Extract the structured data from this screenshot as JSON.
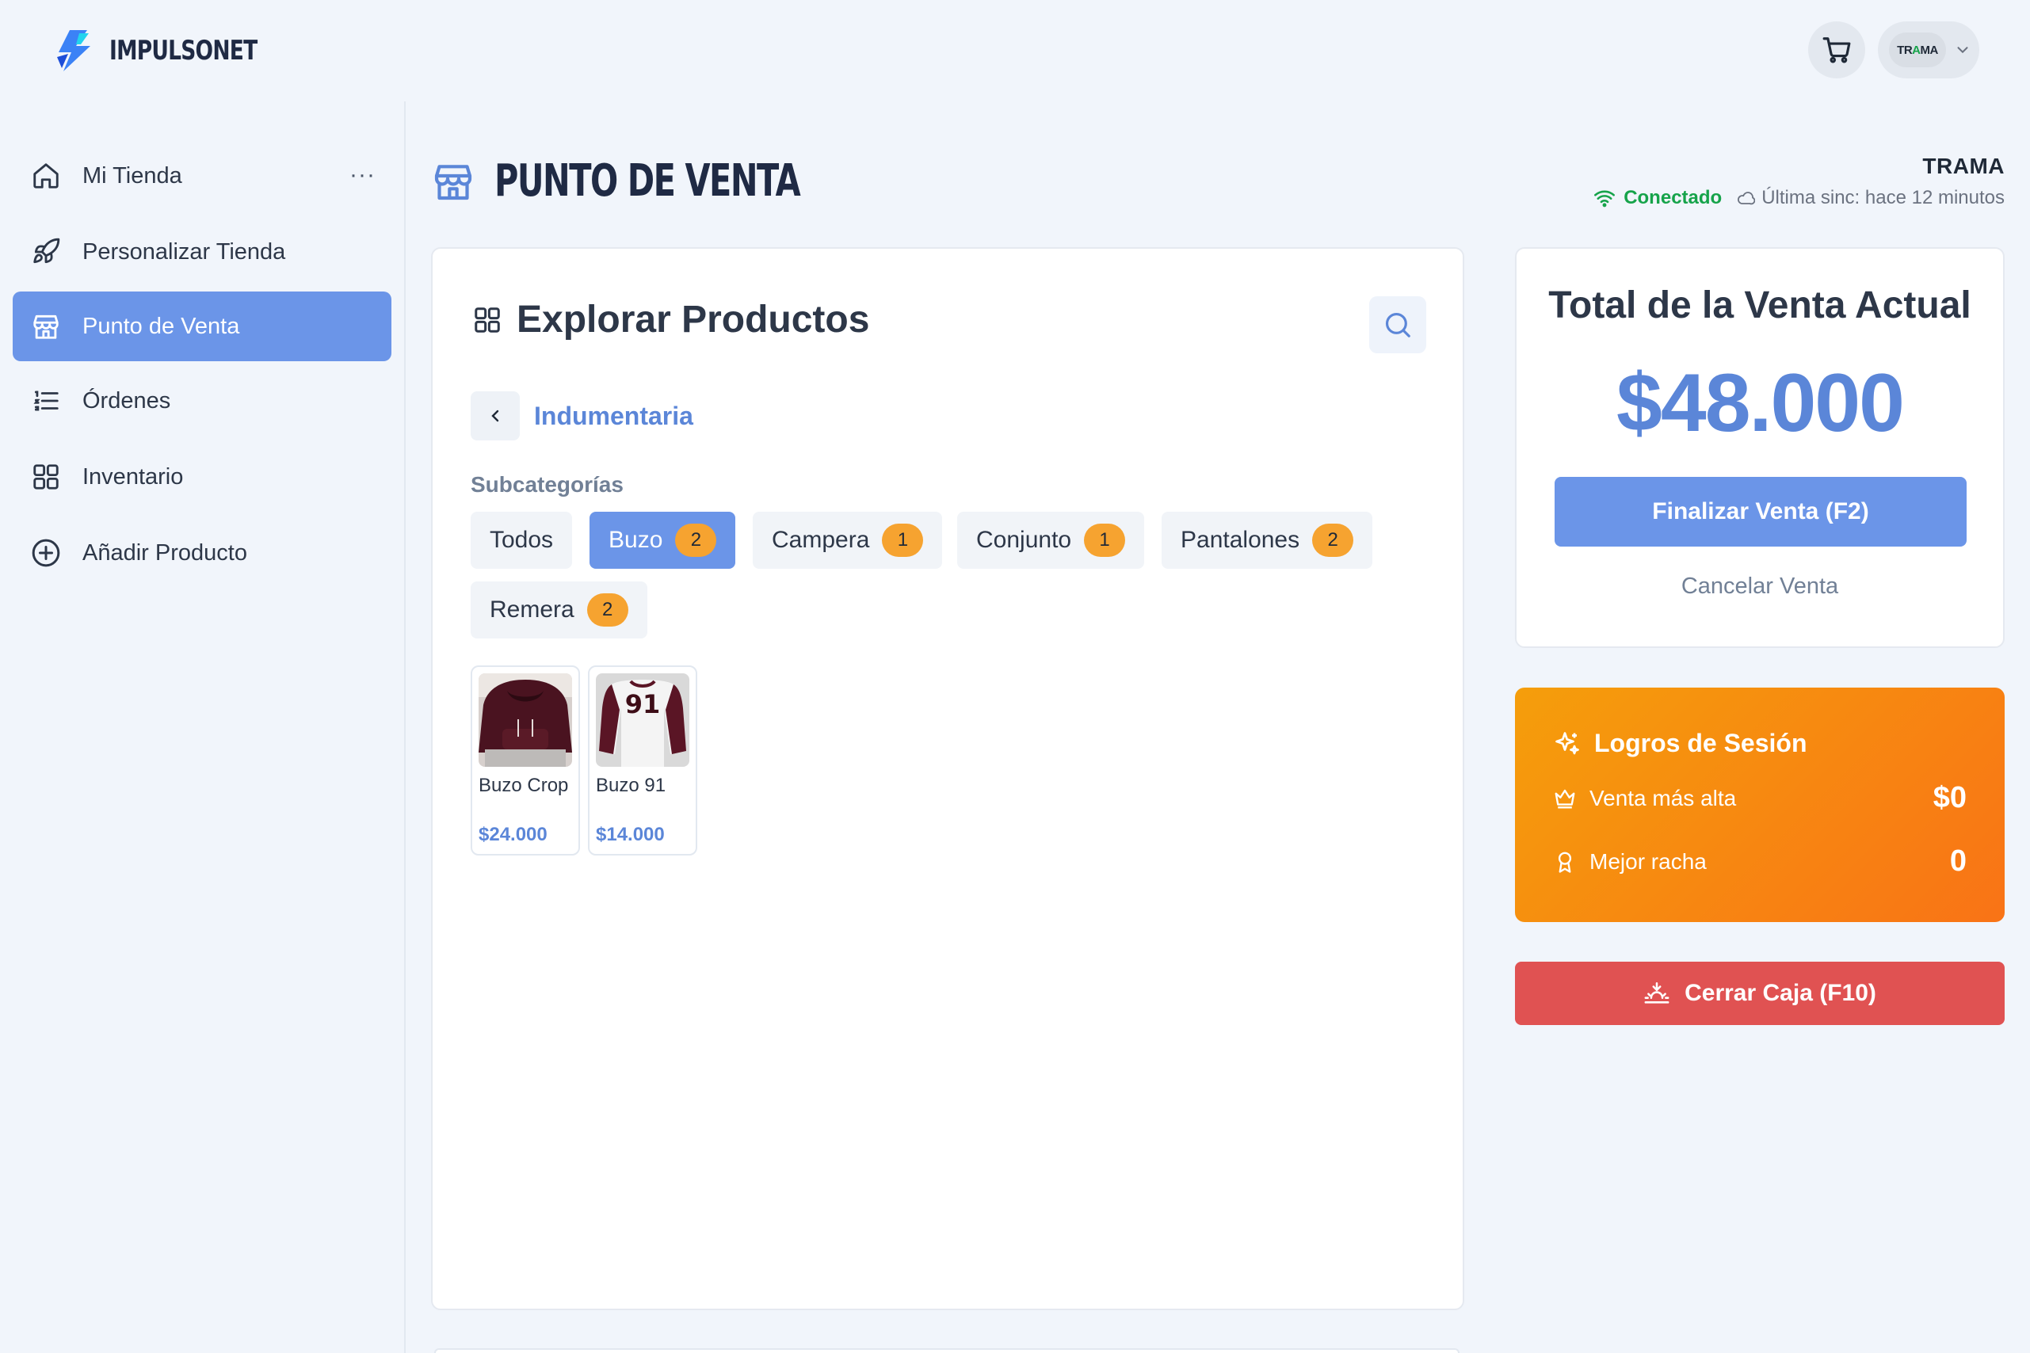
{
  "brand": {
    "name": "IMPULSONET",
    "accent": "#6b95e8"
  },
  "header": {
    "cart_icon": "shopping-cart-icon",
    "account": {
      "avatar_text_pre": "TR",
      "avatar_text_a": "A",
      "avatar_text_post": "MA",
      "chevron_icon": "chevron-down-icon"
    }
  },
  "sidebar": {
    "items": [
      {
        "label": "Mi Tienda",
        "icon": "home-icon",
        "active": false
      },
      {
        "label": "Personalizar Tienda",
        "icon": "rocket-icon",
        "active": false
      },
      {
        "label": "Punto de Venta",
        "icon": "store-icon",
        "active": true
      },
      {
        "label": "Órdenes",
        "icon": "list-icon",
        "active": false
      },
      {
        "label": "Inventario",
        "icon": "grid-icon",
        "active": false
      },
      {
        "label": "Añadir Producto",
        "icon": "plus-circle-icon",
        "active": false
      }
    ],
    "more_label": "···"
  },
  "page": {
    "title": "PUNTO DE VENTA",
    "store_name": "TRAMA",
    "status": "Conectado",
    "sync": "Última sinc: hace 12 minutos"
  },
  "explorer": {
    "title": "Explorar Productos",
    "category": "Indumentaria",
    "subcategories_label": "Subcategorías",
    "chips": [
      {
        "label": "Todos",
        "count": null,
        "active": false
      },
      {
        "label": "Buzo",
        "count": "2",
        "active": true
      },
      {
        "label": "Campera",
        "count": "1",
        "active": false
      },
      {
        "label": "Conjunto",
        "count": "1",
        "active": false
      },
      {
        "label": "Pantalones",
        "count": "2",
        "active": false
      },
      {
        "label": "Remera",
        "count": "2",
        "active": false
      }
    ],
    "products": [
      {
        "name": "Buzo Crop",
        "price": "$24.000"
      },
      {
        "name": "Buzo 91",
        "price": "$14.000",
        "print": "91"
      }
    ]
  },
  "total": {
    "label": "Total de la Venta Actual",
    "amount": "$48.000",
    "finish_button": "Finalizar Venta (F2)",
    "cancel_button": "Cancelar Venta"
  },
  "logros": {
    "title": "Logros de Sesión",
    "rows": [
      {
        "label": "Venta más alta",
        "value": "$0",
        "icon": "crown-icon"
      },
      {
        "label": "Mejor racha",
        "value": "0",
        "icon": "award-icon"
      }
    ],
    "gradient": [
      "#f59e0b",
      "#f97316"
    ]
  },
  "close_register": {
    "label": "Cerrar Caja (F10)",
    "color": "#e05252"
  }
}
